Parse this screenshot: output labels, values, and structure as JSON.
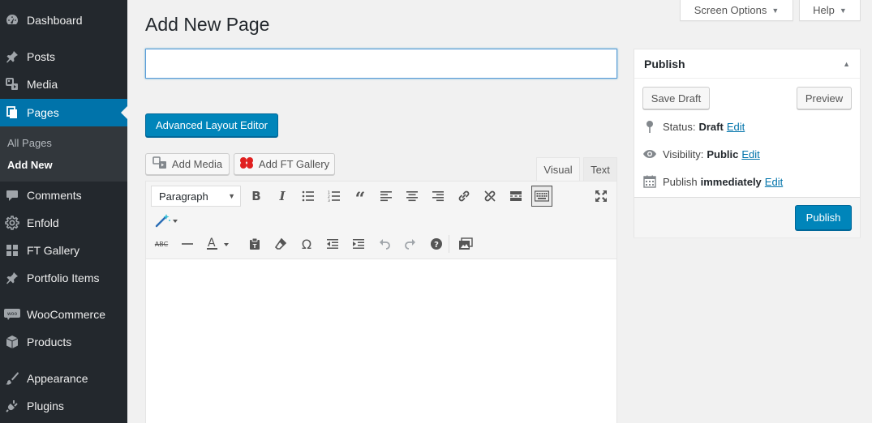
{
  "sidebar": {
    "items": [
      {
        "label": "Dashboard",
        "icon": "dashboard-icon"
      },
      {
        "label": "Posts",
        "icon": "pin-icon"
      },
      {
        "label": "Media",
        "icon": "media-icon"
      },
      {
        "label": "Pages",
        "icon": "pages-icon",
        "current": true
      },
      {
        "label": "Comments",
        "icon": "comment-icon"
      },
      {
        "label": "Enfold",
        "icon": "gear-icon"
      },
      {
        "label": "FT Gallery",
        "icon": "gallery-icon"
      },
      {
        "label": "Portfolio Items",
        "icon": "pin-icon"
      },
      {
        "label": "WooCommerce",
        "icon": "woo-icon"
      },
      {
        "label": "Products",
        "icon": "box-icon"
      },
      {
        "label": "Appearance",
        "icon": "brush-icon"
      },
      {
        "label": "Plugins",
        "icon": "plug-icon"
      }
    ],
    "submenu": [
      {
        "label": "All Pages"
      },
      {
        "label": "Add New",
        "current": true
      }
    ]
  },
  "header": {
    "screen_options": "Screen Options",
    "help": "Help",
    "title": "Add New Page"
  },
  "title_input": {
    "value": "",
    "placeholder": ""
  },
  "advanced_layout_editor": "Advanced Layout Editor",
  "media_buttons": {
    "add_media": "Add Media",
    "add_ft_gallery": "Add FT Gallery"
  },
  "editor_tabs": {
    "visual": "Visual",
    "text": "Text",
    "active": "visual"
  },
  "toolbar": {
    "format_select": "Paragraph"
  },
  "publish": {
    "title": "Publish",
    "save_draft": "Save Draft",
    "preview": "Preview",
    "status_label": "Status:",
    "status_value": "Draft",
    "visibility_label": "Visibility:",
    "visibility_value": "Public",
    "publish_label": "Publish",
    "publish_value": "immediately",
    "edit": "Edit",
    "publish_button": "Publish"
  },
  "colors": {
    "sidebar_bg": "#23282d",
    "accent": "#0073aa",
    "primary_button": "#0085ba",
    "background": "#f1f1f1"
  }
}
